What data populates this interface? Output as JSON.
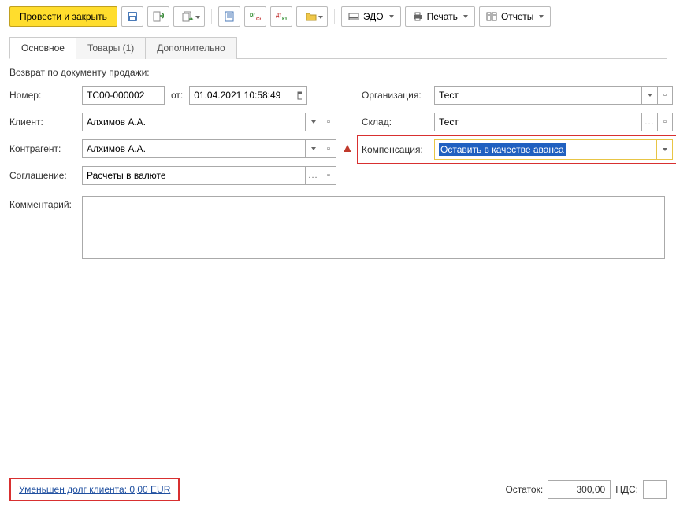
{
  "toolbar": {
    "primary": "Провести и закрыть",
    "edo": "ЭДО",
    "print": "Печать",
    "reports": "Отчеты"
  },
  "tabs": {
    "main": "Основное",
    "goods": "Товары (1)",
    "extra": "Дополнительно"
  },
  "title": "Возврат по документу продажи:",
  "labels": {
    "number": "Номер:",
    "from": "от:",
    "client": "Клиент:",
    "counterparty": "Контрагент:",
    "agreement": "Соглашение:",
    "comment": "Комментарий:",
    "org": "Организация:",
    "warehouse": "Склад:",
    "compensation": "Компенсация:"
  },
  "values": {
    "number": "TC00-000002",
    "date": "01.04.2021 10:58:49",
    "client": "Алхимов А.А.",
    "counterparty": "Алхимов А.А.",
    "agreement": "Расчеты в валюте",
    "comment": "",
    "org": "Тест",
    "warehouse": "Тест",
    "compensation": "Оставить в качестве аванса"
  },
  "footer": {
    "debt_link": "Уменьшен долг клиента: 0,00 EUR",
    "balance_label": "Остаток:",
    "balance_value": "300,00",
    "vat_label": "НДС:",
    "vat_value": ""
  }
}
